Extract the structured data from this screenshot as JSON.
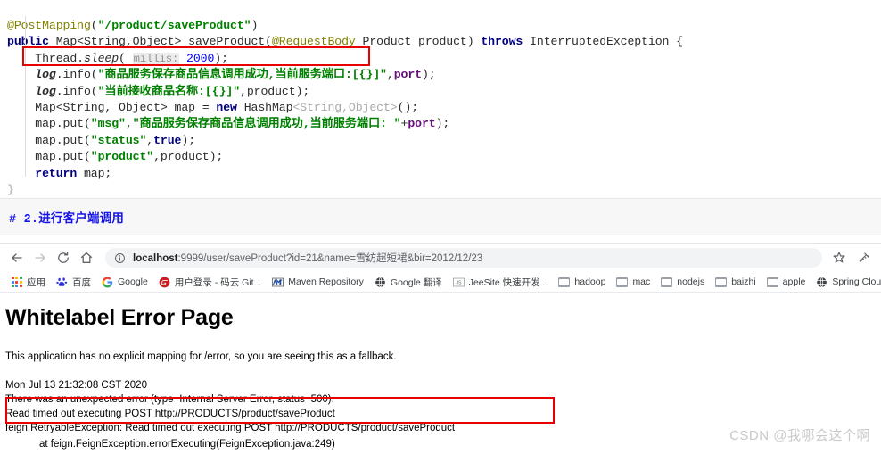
{
  "code": {
    "lines": [
      "@PostMapping(\"/product/saveProduct\")",
      "public Map<String,Object> saveProduct(@RequestBody Product product) throws InterruptedException {",
      "    Thread.sleep( millis: 2000);",
      "    log.info(\"商品服务保存商品信息调用成功,当前服务端口:[{}]\",port);",
      "    log.info(\"当前接收商品名称:[{}]\",product);",
      "    Map<String, Object> map = new HashMap<String,Object>();",
      "    map.put(\"msg\",\"商品服务保存商品信息调用成功,当前服务端口: \"+port);",
      "    map.put(\"status\",true);",
      "    map.put(\"product\",product);",
      "    return map;",
      "}"
    ],
    "annotation": "@PostMapping",
    "mapping_path": "/product/saveProduct",
    "method_signature": "public Map<String,Object> saveProduct(@RequestBody Product product) throws InterruptedException {",
    "sleep_statement": "Thread.sleep( millis: 2000);",
    "sleep_hint": "millis:",
    "sleep_value": "2000",
    "highlight_color": "#e80000"
  },
  "markdown": {
    "heading": "#  2.进行客户端调用",
    "heading_color": "#1414e6"
  },
  "browser": {
    "nav": {
      "back": "back-arrow",
      "forward": "forward-arrow",
      "reload": "reload",
      "home": "home"
    },
    "omnibox": {
      "info_icon": "info-circle-icon",
      "host": "localhost",
      "rest": ":9999/user/saveProduct?id=21&name=雪纺超短裙&bir=2012/12/23",
      "full_url": "localhost:9999/user/saveProduct?id=21&name=雪纺超短裙&bir=2012/12/23"
    },
    "actions": {
      "bookmark": "star-icon",
      "extensions": "extension-icon"
    },
    "bookmarks": [
      {
        "label": "应用",
        "icon": "apps-grid-icon"
      },
      {
        "label": "百度",
        "icon": "baidu-icon"
      },
      {
        "label": "Google",
        "icon": "google-icon"
      },
      {
        "label": "用户登录 - 码云 Git...",
        "icon": "gitee-icon"
      },
      {
        "label": "Maven Repository",
        "icon": "maven-icon"
      },
      {
        "label": "Google 翻译",
        "icon": "globe-icon"
      },
      {
        "label": "JeeSite 快速开发...",
        "icon": "js-icon"
      },
      {
        "label": "hadoop",
        "icon": "folder-icon"
      },
      {
        "label": "mac",
        "icon": "folder-icon"
      },
      {
        "label": "nodejs",
        "icon": "folder-icon"
      },
      {
        "label": "baizhi",
        "icon": "folder-icon"
      },
      {
        "label": "apple",
        "icon": "folder-icon"
      },
      {
        "label": "Spring Cloud Netflix",
        "icon": "globe-icon"
      },
      {
        "label": "",
        "icon": "folder-icon"
      }
    ]
  },
  "error_page": {
    "title": "Whitelabel Error Page",
    "subtitle": "This application has no explicit mapping for /error, so you are seeing this as a fallback.",
    "timestamp": "Mon Jul 13 21:32:08 CST 2020",
    "status_line": "There was an unexpected error (type=Internal Server Error, status=500).",
    "message": "Read timed out executing POST http://PRODUCTS/product/saveProduct",
    "exception": "feign.RetryableException: Read timed out executing POST http://PRODUCTS/product/saveProduct",
    "stack_first": "at feign.FeignException.errorExecuting(FeignException.java:249)",
    "highlight_color": "#e80000"
  },
  "watermark": {
    "text": "CSDN @我哪会这个啊"
  }
}
